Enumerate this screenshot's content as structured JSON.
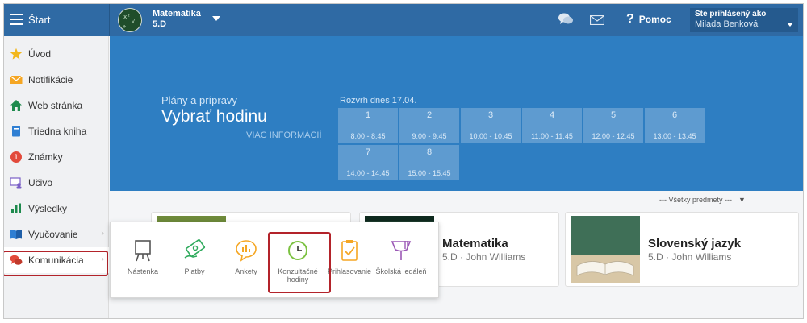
{
  "topbar": {
    "start_label": "Štart",
    "subject_title": "Matematika",
    "subject_class": "5.D",
    "help_label": "Pomoc",
    "user_heading": "Ste prihlásený ako",
    "user_name": "Milada Benková"
  },
  "sidebar": {
    "items": [
      {
        "label": "Úvod",
        "icon": "star-icon"
      },
      {
        "label": "Notifikácie",
        "icon": "envelope-icon"
      },
      {
        "label": "Web stránka",
        "icon": "home-icon"
      },
      {
        "label": "Triedna kniha",
        "icon": "book-icon"
      },
      {
        "label": "Známky",
        "icon": "grades-icon"
      },
      {
        "label": "Učivo",
        "icon": "teacher-icon"
      },
      {
        "label": "Výsledky",
        "icon": "bar-chart-icon"
      },
      {
        "label": "Vyučovanie",
        "icon": "open-book-icon"
      },
      {
        "label": "Komunikácia",
        "icon": "chat-bubbles-icon"
      }
    ]
  },
  "banner": {
    "subtitle": "Plány a prípravy",
    "title": "Vybrať hodinu",
    "more_link": "VIAC INFORMÁCIÍ",
    "schedule_label": "Rozvrh dnes 17.04.",
    "slots": [
      {
        "num": "1",
        "time": "8:00 - 8:45"
      },
      {
        "num": "2",
        "time": "9:00 - 9:45"
      },
      {
        "num": "3",
        "time": "10:00 - 10:45"
      },
      {
        "num": "4",
        "time": "11:00 - 11:45"
      },
      {
        "num": "5",
        "time": "12:00 - 12:45"
      },
      {
        "num": "6",
        "time": "13:00 - 13:45"
      },
      {
        "num": "7",
        "time": "14:00 - 14:45"
      },
      {
        "num": "8",
        "time": "15:00 - 15:45"
      }
    ]
  },
  "filter": {
    "label": "--- Všetky predmety ---",
    "caret": "▼"
  },
  "cards": [
    {
      "title": "Matematika",
      "subtitle": "5.D · John Williams"
    },
    {
      "title": "Slovenský jazyk",
      "subtitle": "5.D · John Williams"
    }
  ],
  "popup": {
    "items": [
      {
        "label": "Nástenka",
        "icon": "board-icon"
      },
      {
        "label": "Platby",
        "icon": "money-icon"
      },
      {
        "label": "Ankety",
        "icon": "poll-icon"
      },
      {
        "label": "Konzultačné hodiny",
        "icon": "clock-icon"
      },
      {
        "label": "Prihlasovanie",
        "icon": "clipboard-check-icon"
      },
      {
        "label": "Školská jedáleň",
        "icon": "cutlery-icon"
      }
    ]
  },
  "colors": {
    "topbar": "#2f6aa4",
    "banner": "#2e7ec2",
    "highlight": "#b3232a"
  }
}
